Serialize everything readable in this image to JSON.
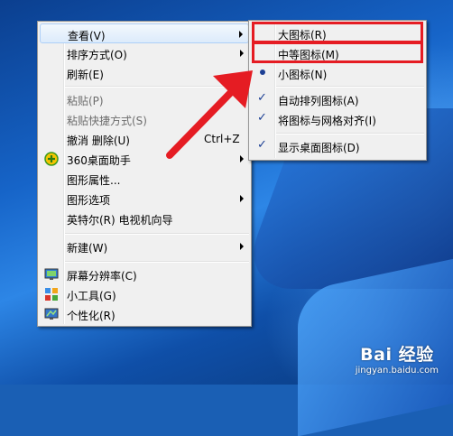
{
  "main_menu": {
    "items": [
      {
        "label": "查看(V)",
        "submenu": true,
        "hover": true
      },
      {
        "label": "排序方式(O)",
        "submenu": true
      },
      {
        "label": "刷新(E)"
      },
      {
        "label": "粘贴(P)",
        "disabled": true
      },
      {
        "label": "粘贴快捷方式(S)",
        "disabled": true
      },
      {
        "label": "撤消 删除(U)",
        "shortcut": "Ctrl+Z"
      },
      {
        "label": "360桌面助手",
        "submenu": true,
        "icon": "360-assistant-icon"
      },
      {
        "label": "图形属性..."
      },
      {
        "label": "图形选项",
        "submenu": true
      },
      {
        "label": "英特尔(R) 电视机向导"
      },
      {
        "label": "新建(W)",
        "submenu": true
      },
      {
        "label": "屏幕分辨率(C)",
        "icon": "screen-resolution-icon"
      },
      {
        "label": "小工具(G)",
        "icon": "gadgets-icon"
      },
      {
        "label": "个性化(R)",
        "icon": "personalize-icon"
      }
    ]
  },
  "view_submenu": {
    "items": [
      {
        "label": "大图标(R)",
        "highlighted": true
      },
      {
        "label": "中等图标(M)",
        "highlighted": true
      },
      {
        "label": "小图标(N)",
        "state": "radio"
      },
      {
        "label": "自动排列图标(A)",
        "state": "check"
      },
      {
        "label": "将图标与网格对齐(I)",
        "state": "check"
      },
      {
        "label": "显示桌面图标(D)",
        "state": "check"
      }
    ]
  },
  "colors": {
    "highlight_box": "#e51c23",
    "annotation_arrow": "#e51c23"
  },
  "watermark": {
    "logo": "Bai  经验",
    "url": "jingyan.baidu.com"
  }
}
